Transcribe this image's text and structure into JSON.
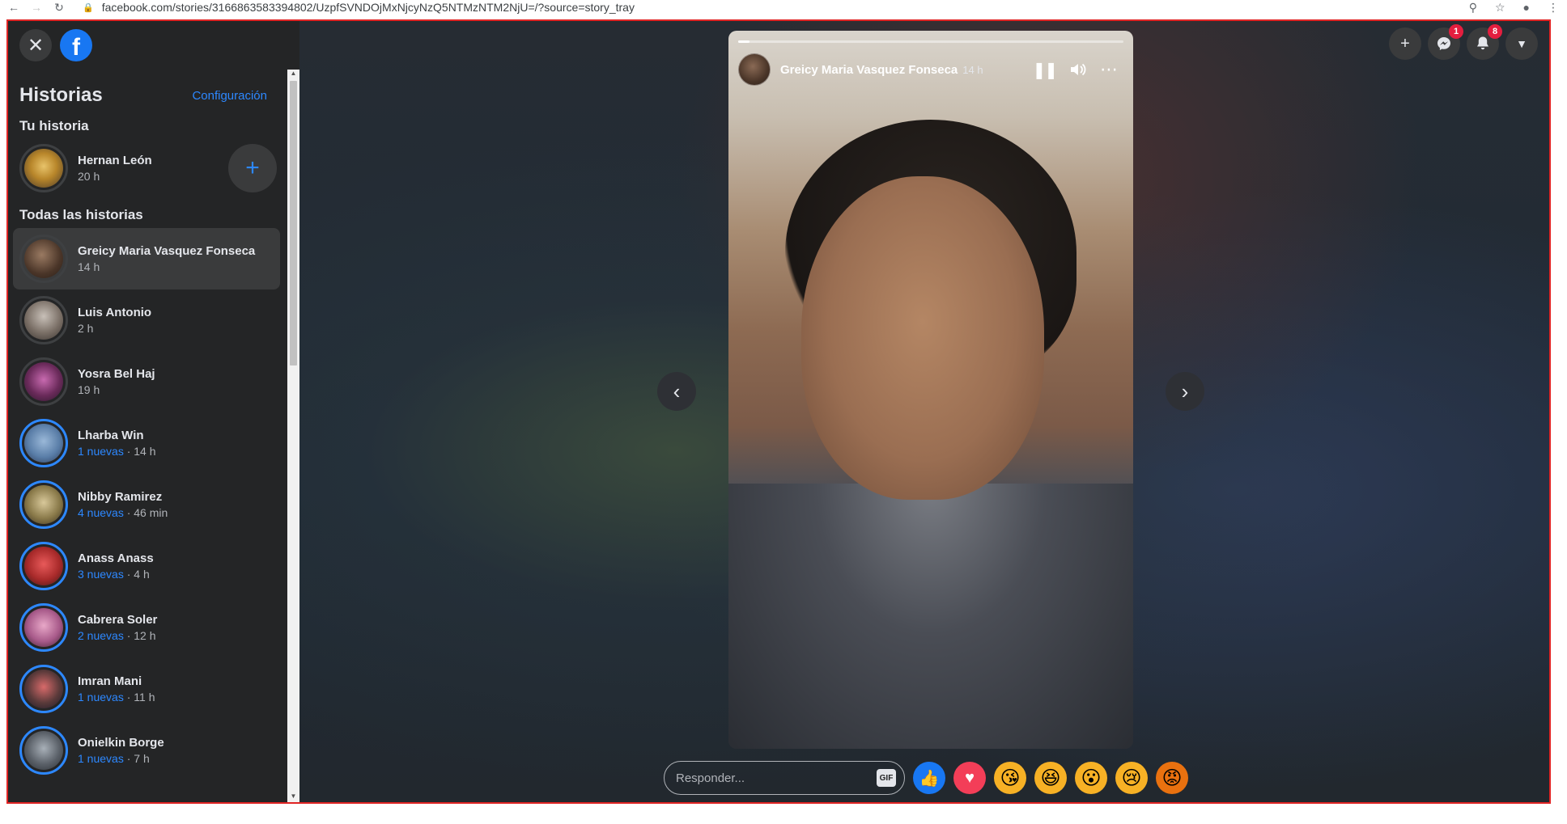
{
  "browser": {
    "url": "facebook.com/stories/3166863583394802/UzpfSVNDOjMxNjcyNzQ5NTMzNTM2NjU=/?source=story_tray"
  },
  "sidebar": {
    "title": "Historias",
    "settings_link": "Configuración",
    "your_story_label": "Tu historia",
    "your_story": {
      "name": "Hernan León",
      "time": "20 h"
    },
    "all_stories_label": "Todas las historias",
    "stories": [
      {
        "name": "Greicy Maria Vasquez Fonseca",
        "new": "",
        "time": "14 h",
        "selected": true
      },
      {
        "name": "Luis Antonio",
        "new": "",
        "time": "2 h"
      },
      {
        "name": "Yosra Bel Haj",
        "new": "",
        "time": "19 h"
      },
      {
        "name": "Lharba Win",
        "new": "1 nuevas",
        "time": " · 14 h"
      },
      {
        "name": "Nibby Ramirez",
        "new": "4 nuevas",
        "time": " · 46 min"
      },
      {
        "name": "Anass Anass",
        "new": "3 nuevas",
        "time": " · 4 h"
      },
      {
        "name": "Cabrera Soler",
        "new": "2 nuevas",
        "time": " · 12 h"
      },
      {
        "name": "Imran Mani",
        "new": "1 nuevas",
        "time": " · 11 h"
      },
      {
        "name": "Onielkin Borge",
        "new": "1 nuevas",
        "time": " · 7 h"
      }
    ]
  },
  "top_actions": {
    "messenger_badge": "1",
    "notifications_badge": "8"
  },
  "story_viewer": {
    "author": "Greicy Maria Vasquez Fonseca",
    "time": "14 h",
    "progress_fraction": 0.03
  },
  "reply": {
    "placeholder": "Responder...",
    "gif_label": "GIF"
  },
  "icons": {
    "close": "close-icon",
    "facebook": "facebook-logo",
    "add": "plus-icon",
    "messenger": "messenger-icon",
    "notifications": "bell-icon",
    "account": "caret-down-icon",
    "pause": "pause-icon",
    "volume": "volume-icon",
    "more": "more-icon"
  },
  "colors": {
    "accent": "#2d88ff",
    "badge": "#e41e3f",
    "sidebar_bg": "#242526"
  }
}
